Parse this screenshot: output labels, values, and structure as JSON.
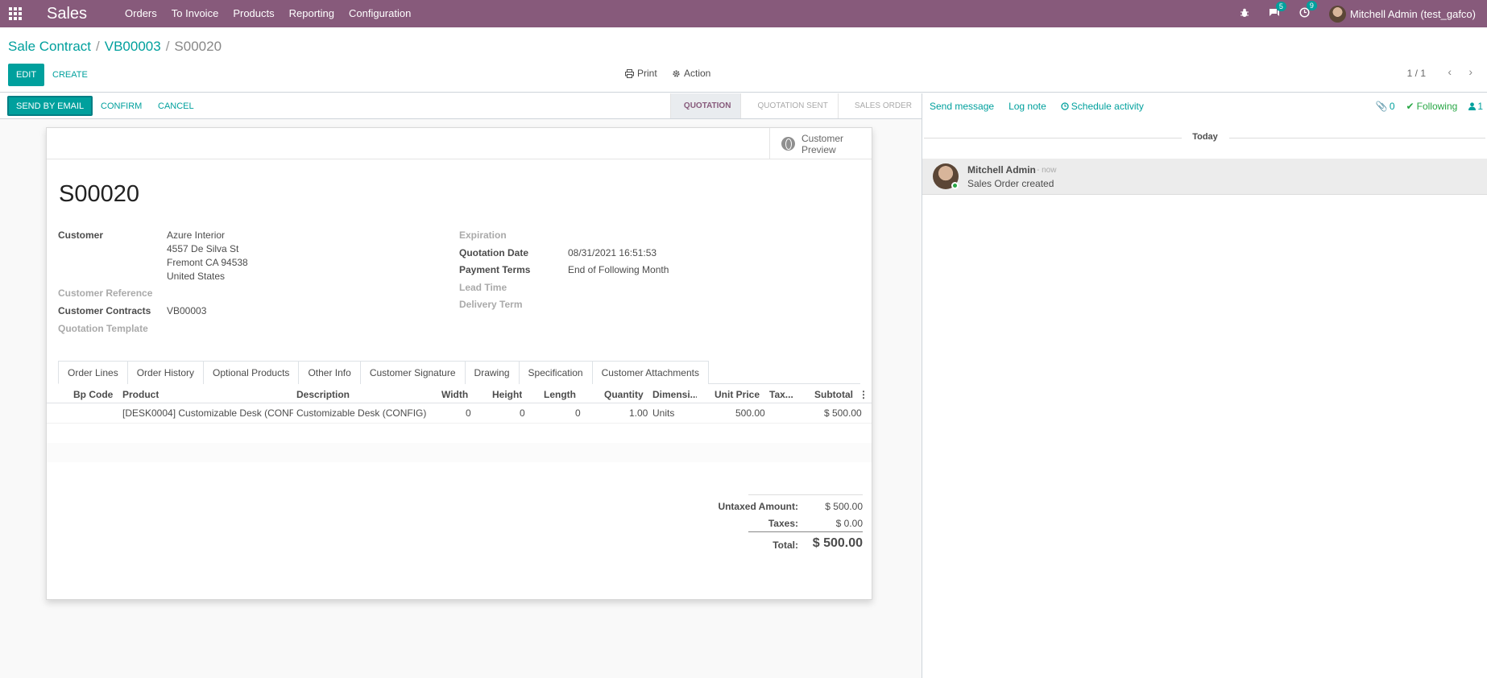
{
  "navbar": {
    "app_name": "Sales",
    "menu": [
      "Orders",
      "To Invoice",
      "Products",
      "Reporting",
      "Configuration"
    ],
    "messages_badge": "5",
    "activities_badge": "9",
    "user": "Mitchell Admin (test_gafco)"
  },
  "breadcrumb": {
    "items": [
      "Sale Contract",
      "VB00003"
    ],
    "current": "S00020"
  },
  "control": {
    "edit": "EDIT",
    "create": "CREATE",
    "print": "Print",
    "action": "Action",
    "pager": "1 / 1"
  },
  "statusbar": {
    "send_email": "SEND BY EMAIL",
    "confirm": "CONFIRM",
    "cancel": "CANCEL",
    "stages": [
      "QUOTATION",
      "QUOTATION SENT",
      "SALES ORDER"
    ],
    "active_stage": "QUOTATION"
  },
  "form": {
    "preview_line1": "Customer",
    "preview_line2": "Preview",
    "title": "S00020",
    "customer_label": "Customer",
    "customer_name": "Azure Interior",
    "address": [
      "4557 De Silva St",
      "Fremont CA 94538",
      "United States"
    ],
    "customer_reference_label": "Customer Reference",
    "customer_contracts_label": "Customer Contracts",
    "customer_contracts_value": "VB00003",
    "quotation_template_label": "Quotation Template",
    "expiration_label": "Expiration",
    "quotation_date_label": "Quotation Date",
    "quotation_date_value": "08/31/2021 16:51:53",
    "payment_terms_label": "Payment Terms",
    "payment_terms_value": "End of Following Month",
    "lead_time_label": "Lead Time",
    "delivery_term_label": "Delivery Term"
  },
  "tabs": [
    "Order Lines",
    "Order History",
    "Optional Products",
    "Other Info",
    "Customer Signature",
    "Drawing",
    "Specification",
    "Customer Attachments"
  ],
  "lines": {
    "headers": [
      "Bp Code",
      "Product",
      "Description",
      "Width",
      "Height",
      "Length",
      "Quantity",
      "Dimensi...",
      "Unit Price",
      "Tax...",
      "Subtotal"
    ],
    "rows": [
      {
        "bp_code": "",
        "product": "[DESK0004] Customizable Desk (CONF...",
        "description": "Customizable Desk (CONFIG)",
        "width": "0",
        "height": "0",
        "length": "0",
        "quantity": "1.00",
        "dimension": "Units",
        "unit_price": "500.00",
        "tax": "",
        "subtotal": "$ 500.00"
      }
    ]
  },
  "totals": {
    "untaxed_label": "Untaxed Amount:",
    "untaxed_value": "$ 500.00",
    "taxes_label": "Taxes:",
    "taxes_value": "$ 0.00",
    "total_label": "Total:",
    "total_value": "$ 500.00"
  },
  "chatter": {
    "send_message": "Send message",
    "log_note": "Log note",
    "schedule_activity": "Schedule activity",
    "attachments_count": "0",
    "following": "Following",
    "followers_count": "1",
    "day_label": "Today",
    "message": {
      "author": "Mitchell Admin",
      "time": "- now",
      "body": "Sales Order created"
    }
  }
}
